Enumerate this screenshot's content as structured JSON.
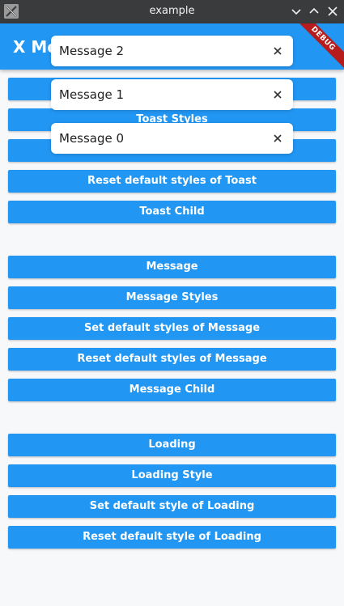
{
  "window": {
    "title": "example",
    "icons": [
      "app-icon",
      "minimize-icon",
      "maximize-icon",
      "close-icon"
    ]
  },
  "appbar": {
    "title": "X Me",
    "debug_label": "DEBUG"
  },
  "colors": {
    "primary": "#2196f3",
    "titlebar": "#3a3b3d",
    "debug": "#b71c1c",
    "background": "#f7f8fa"
  },
  "buttons": {
    "toast_styles": "Toast Styles",
    "reset_default_styles_toast": "Reset default styles of Toast",
    "toast_child": "Toast Child",
    "message": "Message",
    "message_styles": "Message Styles",
    "set_default_styles_message": "Set default styles of Message",
    "reset_default_styles_message": "Reset default styles of Message",
    "message_child": "Message Child",
    "loading": "Loading",
    "loading_style": "Loading Style",
    "set_default_style_loading": "Set default style of Loading",
    "reset_default_style_loading": "Reset default style of Loading"
  },
  "toasts": [
    {
      "text": "Message 2"
    },
    {
      "text": "Message 1"
    },
    {
      "text": "Message 0"
    }
  ]
}
